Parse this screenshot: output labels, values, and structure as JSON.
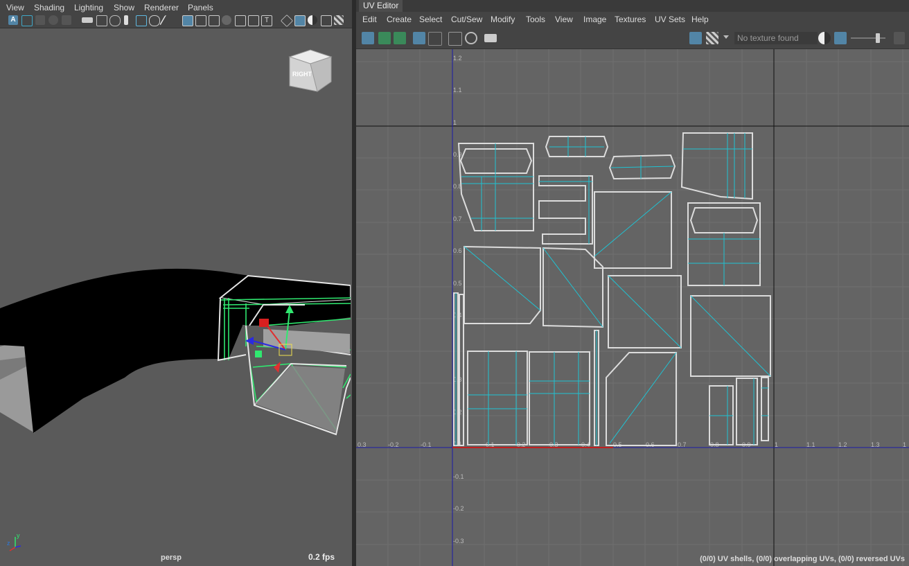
{
  "viewport": {
    "menu": [
      "View",
      "Shading",
      "Lighting",
      "Show",
      "Renderer",
      "Panels"
    ],
    "view_cube_label": "RIGHT",
    "camera_name": "persp",
    "fps": "0.2 fps",
    "axis_labels": {
      "y": "y",
      "z": "z"
    }
  },
  "uv_editor": {
    "title": "UV Editor",
    "menu": [
      "Edit",
      "Create",
      "Select",
      "Cut/Sew",
      "Modify",
      "Tools",
      "View",
      "Image",
      "Textures",
      "UV Sets",
      "Help"
    ],
    "texture_placeholder": "No texture found",
    "status": "(0/0) UV shells, (0/0) overlapping UVs, (0/0) reversed UVs",
    "x_ticks": [
      "0.3",
      "-0.2",
      "-0.1",
      "0.1",
      "0.2",
      "0.3",
      "0.4",
      "0.5",
      "0.6",
      "0.7",
      "0.8",
      "0.9",
      "1",
      "1.1",
      "1.2",
      "1.3",
      "1"
    ],
    "y_ticks": [
      "1.2",
      "1.1",
      "1",
      "0.9",
      "0.8",
      "0.7",
      "0.6",
      "0.5",
      "0.4",
      "0.3",
      "0.2",
      "0.1",
      "-0.1",
      "-0.2",
      "-0.3"
    ]
  },
  "colors": {
    "accent": "#5285a6",
    "uv_wire": "#dcdcdc",
    "uv_inner": "#1fc3d3",
    "selection_green": "#30e870",
    "axis_blue": "#1a1aa8"
  }
}
